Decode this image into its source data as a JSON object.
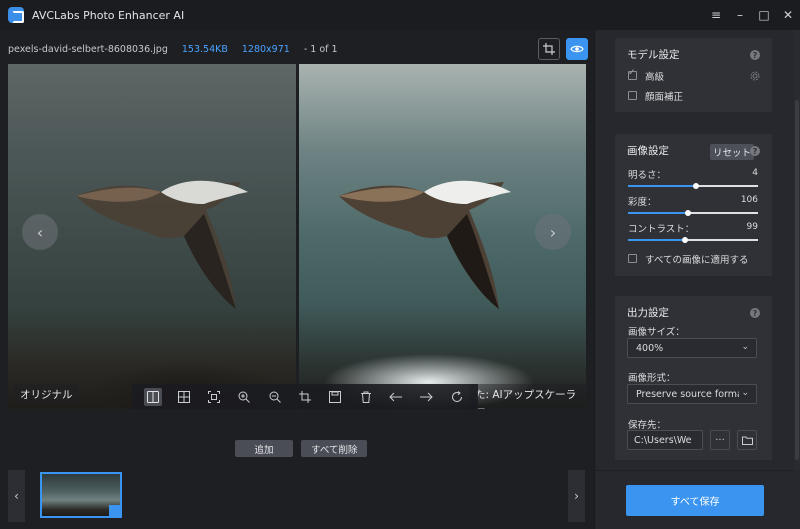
{
  "app": {
    "title": "AVCLabs Photo Enhancer AI"
  },
  "window_controls": {
    "menu": "≡",
    "minimize": "–",
    "maximize": "□",
    "close": "✕"
  },
  "file": {
    "name": "pexels-david-selbert-8608036.jpg",
    "size": "153.54KB",
    "resolution": "1280x971",
    "count": "- 1 of 1"
  },
  "preview": {
    "left_label": "オリジナル",
    "right_label": "た: AIアップスケーラー",
    "prev_arrow": "‹",
    "next_arrow": "›"
  },
  "actions": {
    "add": "追加",
    "remove_all": "すべて削除"
  },
  "thumbnails": {
    "prev": "‹",
    "next": "›"
  },
  "model_settings": {
    "title": "モデル設定",
    "help": "?",
    "options": [
      {
        "label": "高級",
        "checked": true
      },
      {
        "label": "顔面補正",
        "checked": false
      }
    ]
  },
  "image_settings": {
    "title": "画像設定",
    "reset": "リセット",
    "help": "?",
    "sliders": [
      {
        "label": "明るさ：",
        "value": "4",
        "percent": 0.52
      },
      {
        "label": "彩度：",
        "value": "106",
        "percent": 0.46
      },
      {
        "label": "コントラスト：",
        "value": "99",
        "percent": 0.44
      }
    ],
    "apply_all": "すべての画像に適用する"
  },
  "output_settings": {
    "title": "出力設定",
    "help": "?",
    "size_label": "画像サイズ：",
    "size_value": "400%",
    "format_label": "画像形式：",
    "format_value": "Preserve source format",
    "dest_label": "保存先：",
    "dest_value": "C:\\Users\\We",
    "more": "···"
  },
  "save_all": "すべて保存",
  "colors": {
    "accent": "#3b95f0",
    "panel": "#303137",
    "bg": "#1e1f23"
  }
}
